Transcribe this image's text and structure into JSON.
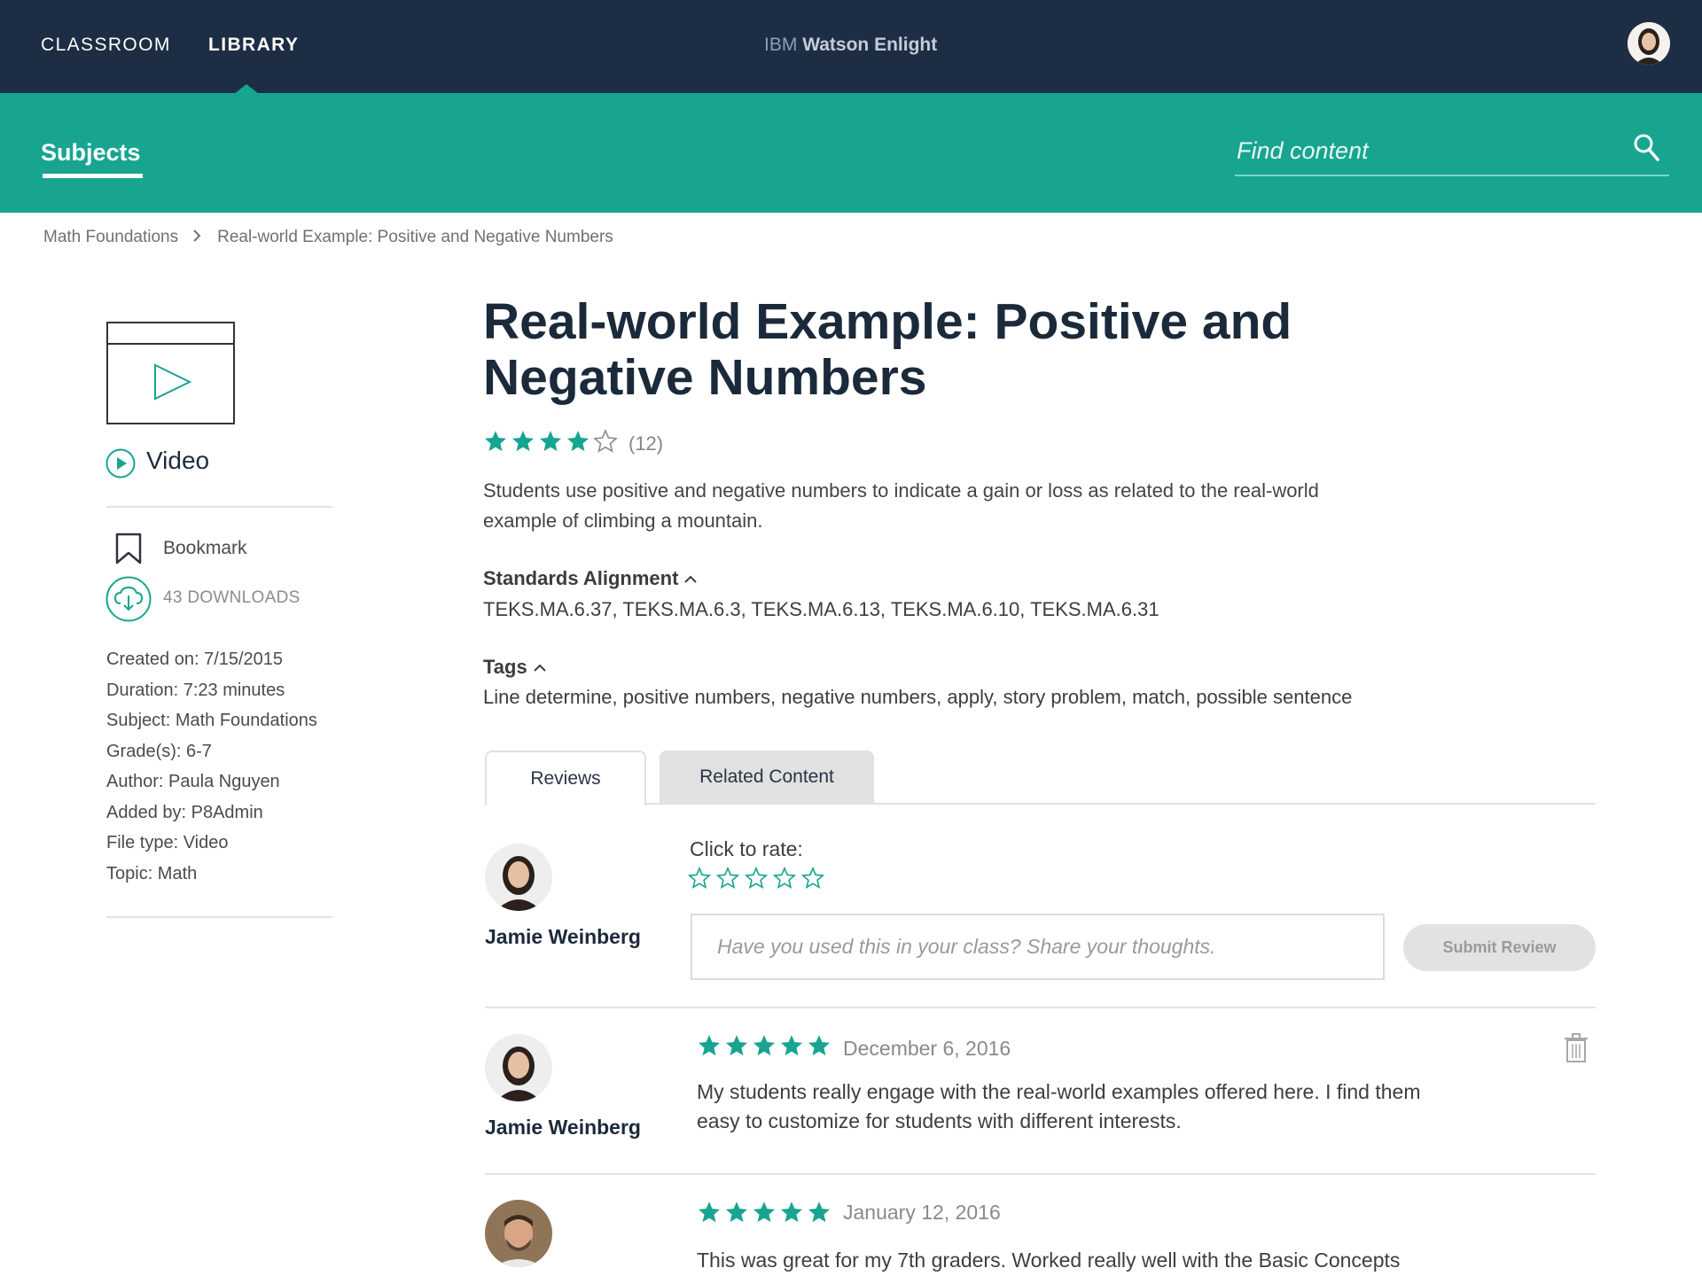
{
  "nav": {
    "classroom": "CLASSROOM",
    "library": "LIBRARY",
    "brand_prefix": "IBM",
    "brand_name": "Watson Enlight"
  },
  "subnav": {
    "subjects": "Subjects",
    "search_placeholder": "Find content"
  },
  "breadcrumb": {
    "items": [
      "Math Foundations",
      "Real-world Example: Positive and Negative Numbers"
    ]
  },
  "resource": {
    "type_label": "Video",
    "bookmark_label": "Bookmark",
    "downloads_label": "43 DOWNLOADS",
    "meta": [
      "Created on: 7/15/2015",
      "Duration: 7:23 minutes",
      "Subject: Math Foundations",
      "Grade(s): 6-7",
      "Author: Paula Nguyen",
      "Added by: P8Admin",
      "File type: Video",
      "Topic: Math"
    ]
  },
  "main": {
    "title_line1": "Real-world Example: Positive and",
    "title_line2": "Negative Numbers",
    "rating": 4,
    "rating_max": 5,
    "rating_count": "(12)",
    "description": "Students use positive and negative numbers to indicate a gain or loss as related to the real-world example of climbing a mountain.",
    "standards_heading": "Standards Alignment",
    "standards": "TEKS.MA.6.37, TEKS.MA.6.3, TEKS.MA.6.13, TEKS.MA.6.10, TEKS.MA.6.31",
    "tags_heading": "Tags",
    "tags": "Line determine, positive numbers, negative numbers, apply, story problem, match, possible sentence"
  },
  "tabs": {
    "reviews": "Reviews",
    "related": "Related Content"
  },
  "composer": {
    "user_name": "Jamie Weinberg",
    "click_to_rate": "Click to rate:",
    "placeholder": "Have you used this in your class? Share your thoughts.",
    "submit": "Submit Review"
  },
  "reviews": [
    {
      "name": "Jamie Weinberg",
      "rating": 5,
      "date": "December 6, 2016",
      "text": "My students really engage with the real-world examples offered here. I find them easy to customize for students with different interests."
    },
    {
      "name": "",
      "rating": 5,
      "date": "January 12, 2016",
      "text": "This was great for my 7th graders. Worked really well with the Basic Concepts"
    }
  ],
  "colors": {
    "navy": "#1d2d44",
    "teal": "#17a590",
    "star": "#17a590"
  }
}
